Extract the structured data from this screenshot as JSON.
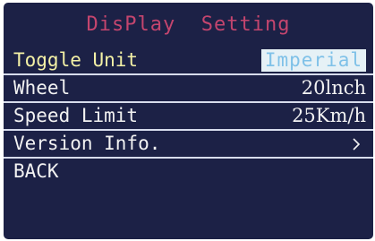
{
  "screen": {
    "title": "DisPlay  Setting"
  },
  "menu": {
    "items": [
      {
        "label": "Toggle Unit",
        "value": "Imperial"
      },
      {
        "label": "Wheel",
        "value": "20lnch"
      },
      {
        "label": "Speed Limit",
        "value": "25Km/h"
      },
      {
        "label": "Version Info.",
        "value": ""
      },
      {
        "label": "BACK",
        "value": ""
      }
    ]
  },
  "colors": {
    "background": "#1c2146",
    "title": "#c4456e",
    "selected_label": "#f4f1a6",
    "divider": "#d7dcec",
    "highlight_bg": "#e6f1f6",
    "highlight_text": "#7fc1e8"
  },
  "icons": {
    "version_info": "chevron-right-icon"
  }
}
